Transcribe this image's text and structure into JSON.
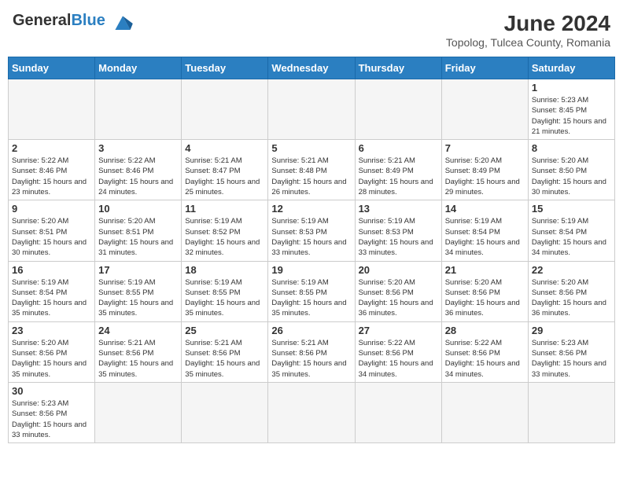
{
  "header": {
    "logo_general": "General",
    "logo_blue": "Blue",
    "month_year": "June 2024",
    "subtitle": "Topolog, Tulcea County, Romania"
  },
  "days_of_week": [
    "Sunday",
    "Monday",
    "Tuesday",
    "Wednesday",
    "Thursday",
    "Friday",
    "Saturday"
  ],
  "weeks": [
    [
      {
        "day": "",
        "info": ""
      },
      {
        "day": "",
        "info": ""
      },
      {
        "day": "",
        "info": ""
      },
      {
        "day": "",
        "info": ""
      },
      {
        "day": "",
        "info": ""
      },
      {
        "day": "",
        "info": ""
      },
      {
        "day": "1",
        "info": "Sunrise: 5:23 AM\nSunset: 8:45 PM\nDaylight: 15 hours and 21 minutes."
      }
    ],
    [
      {
        "day": "2",
        "info": "Sunrise: 5:22 AM\nSunset: 8:46 PM\nDaylight: 15 hours and 23 minutes."
      },
      {
        "day": "3",
        "info": "Sunrise: 5:22 AM\nSunset: 8:46 PM\nDaylight: 15 hours and 24 minutes."
      },
      {
        "day": "4",
        "info": "Sunrise: 5:21 AM\nSunset: 8:47 PM\nDaylight: 15 hours and 25 minutes."
      },
      {
        "day": "5",
        "info": "Sunrise: 5:21 AM\nSunset: 8:48 PM\nDaylight: 15 hours and 26 minutes."
      },
      {
        "day": "6",
        "info": "Sunrise: 5:21 AM\nSunset: 8:49 PM\nDaylight: 15 hours and 28 minutes."
      },
      {
        "day": "7",
        "info": "Sunrise: 5:20 AM\nSunset: 8:49 PM\nDaylight: 15 hours and 29 minutes."
      },
      {
        "day": "8",
        "info": "Sunrise: 5:20 AM\nSunset: 8:50 PM\nDaylight: 15 hours and 30 minutes."
      }
    ],
    [
      {
        "day": "9",
        "info": "Sunrise: 5:20 AM\nSunset: 8:51 PM\nDaylight: 15 hours and 30 minutes."
      },
      {
        "day": "10",
        "info": "Sunrise: 5:20 AM\nSunset: 8:51 PM\nDaylight: 15 hours and 31 minutes."
      },
      {
        "day": "11",
        "info": "Sunrise: 5:19 AM\nSunset: 8:52 PM\nDaylight: 15 hours and 32 minutes."
      },
      {
        "day": "12",
        "info": "Sunrise: 5:19 AM\nSunset: 8:53 PM\nDaylight: 15 hours and 33 minutes."
      },
      {
        "day": "13",
        "info": "Sunrise: 5:19 AM\nSunset: 8:53 PM\nDaylight: 15 hours and 33 minutes."
      },
      {
        "day": "14",
        "info": "Sunrise: 5:19 AM\nSunset: 8:54 PM\nDaylight: 15 hours and 34 minutes."
      },
      {
        "day": "15",
        "info": "Sunrise: 5:19 AM\nSunset: 8:54 PM\nDaylight: 15 hours and 34 minutes."
      }
    ],
    [
      {
        "day": "16",
        "info": "Sunrise: 5:19 AM\nSunset: 8:54 PM\nDaylight: 15 hours and 35 minutes."
      },
      {
        "day": "17",
        "info": "Sunrise: 5:19 AM\nSunset: 8:55 PM\nDaylight: 15 hours and 35 minutes."
      },
      {
        "day": "18",
        "info": "Sunrise: 5:19 AM\nSunset: 8:55 PM\nDaylight: 15 hours and 35 minutes."
      },
      {
        "day": "19",
        "info": "Sunrise: 5:19 AM\nSunset: 8:55 PM\nDaylight: 15 hours and 35 minutes."
      },
      {
        "day": "20",
        "info": "Sunrise: 5:20 AM\nSunset: 8:56 PM\nDaylight: 15 hours and 36 minutes."
      },
      {
        "day": "21",
        "info": "Sunrise: 5:20 AM\nSunset: 8:56 PM\nDaylight: 15 hours and 36 minutes."
      },
      {
        "day": "22",
        "info": "Sunrise: 5:20 AM\nSunset: 8:56 PM\nDaylight: 15 hours and 36 minutes."
      }
    ],
    [
      {
        "day": "23",
        "info": "Sunrise: 5:20 AM\nSunset: 8:56 PM\nDaylight: 15 hours and 35 minutes."
      },
      {
        "day": "24",
        "info": "Sunrise: 5:21 AM\nSunset: 8:56 PM\nDaylight: 15 hours and 35 minutes."
      },
      {
        "day": "25",
        "info": "Sunrise: 5:21 AM\nSunset: 8:56 PM\nDaylight: 15 hours and 35 minutes."
      },
      {
        "day": "26",
        "info": "Sunrise: 5:21 AM\nSunset: 8:56 PM\nDaylight: 15 hours and 35 minutes."
      },
      {
        "day": "27",
        "info": "Sunrise: 5:22 AM\nSunset: 8:56 PM\nDaylight: 15 hours and 34 minutes."
      },
      {
        "day": "28",
        "info": "Sunrise: 5:22 AM\nSunset: 8:56 PM\nDaylight: 15 hours and 34 minutes."
      },
      {
        "day": "29",
        "info": "Sunrise: 5:23 AM\nSunset: 8:56 PM\nDaylight: 15 hours and 33 minutes."
      }
    ],
    [
      {
        "day": "30",
        "info": "Sunrise: 5:23 AM\nSunset: 8:56 PM\nDaylight: 15 hours and 33 minutes."
      },
      {
        "day": "",
        "info": ""
      },
      {
        "day": "",
        "info": ""
      },
      {
        "day": "",
        "info": ""
      },
      {
        "day": "",
        "info": ""
      },
      {
        "day": "",
        "info": ""
      },
      {
        "day": "",
        "info": ""
      }
    ]
  ]
}
